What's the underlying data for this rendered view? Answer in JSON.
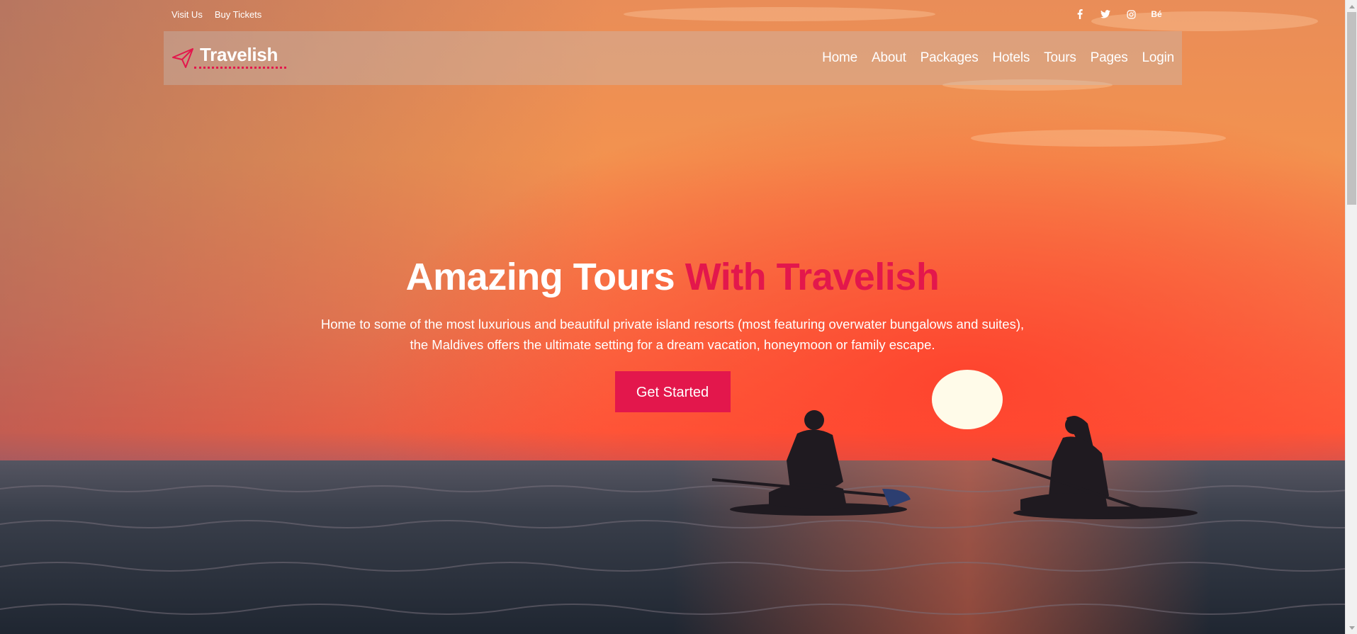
{
  "topbar": {
    "links": [
      "Visit Us",
      "Buy Tickets"
    ],
    "social": [
      {
        "icon": "facebook-icon"
      },
      {
        "icon": "twitter-icon"
      },
      {
        "icon": "instagram-icon"
      },
      {
        "icon": "behance-icon",
        "label": "Bé"
      }
    ]
  },
  "brand": {
    "name": "Travelish",
    "logo_icon": "paper-plane-icon",
    "accent": "#e3174c"
  },
  "nav": {
    "items": [
      "Home",
      "About",
      "Packages",
      "Hotels",
      "Tours",
      "Pages",
      "Login"
    ]
  },
  "hero": {
    "title_main": "Amazing Tours",
    "title_accent": "With Travelish",
    "description_line1": "Home to some of the most luxurious and beautiful private island resorts (most featuring overwater bungalows and suites),",
    "description_line2": "the Maldives offers the ultimate setting for a dream vacation, honeymoon or family escape.",
    "cta_label": "Get Started"
  },
  "colors": {
    "accent": "#e3174c",
    "sky_top": "#e88a52",
    "sky_bottom": "#ff5a38",
    "sea": "#2a3340"
  }
}
